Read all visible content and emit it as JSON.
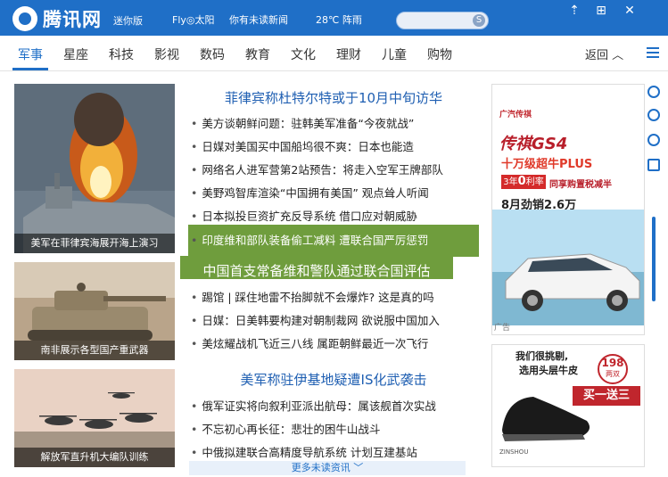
{
  "header": {
    "brand": "腾讯网",
    "mini_label": "迷你版",
    "weather_location": "Fly◎太阳",
    "news_notice": "你有未读新闻",
    "weather": "28℃ 阵雨"
  },
  "window": {
    "pin": "⇡",
    "restore": "⊞",
    "close": "✕"
  },
  "nav": {
    "items": [
      "军事",
      "星座",
      "科技",
      "影视",
      "数码",
      "教育",
      "文化",
      "理财",
      "儿童",
      "购物"
    ],
    "back_label": "返回 ︿"
  },
  "photos": [
    {
      "caption": "美军在菲律宾海展开海上演习"
    },
    {
      "caption": "南非展示各型国产重武器"
    },
    {
      "caption": "解放军直升机大编队训练"
    }
  ],
  "news": {
    "headline1": "菲律宾称杜特尔特或于10月中旬访华",
    "group1": [
      "美方谈朝鲜问题：驻韩美军准备“今夜就战”",
      "日媒对美国买中国船坞很不爽：日本也能造",
      "网络名人进军营第2站预告：将走入空军王牌部队",
      "美野鸡智库渲染“中国拥有美国” 观点耸人听闻",
      "日本拟投巨资扩充反导系统 借口应对朝威胁"
    ],
    "highlight_item": "印度维和部队装备偷工减料 遭联合国严厉惩罚",
    "headline2": "中国首支常备维和警队通过联合国评估",
    "group2": [
      "踢馆 | 踩住地雷不抬脚就不会爆炸? 这是真的吗",
      "日媒：日美韩要构建对朝制裁网 欲说服中国加入",
      "美炫耀战机飞近三八线 属距朝鲜最近一次飞行"
    ],
    "headline3": "美军称驻伊基地疑遭IS化武袭击",
    "group3": [
      "俄军证实将向叙利亚派出航母：属该舰首次实战",
      "不忘初心再长征：悲壮的困牛山战斗",
      "中俄拟建联合高精度导航系统 计划互建基站"
    ],
    "more": "更多未读资讯 ﹀"
  },
  "ads": {
    "ad1": {
      "brand": "广汽传祺",
      "model": "传祺GS4",
      "slogan": "十万级超牛PLUS",
      "rate_prefix": "3年",
      "rate_value": "0",
      "rate_suffix": "利率",
      "promo": "同享购置税减半",
      "sales": "8月劲销2.6万",
      "tag": "广告"
    },
    "ad2": {
      "line1": "我们很挑剔,",
      "line2": "选用头层牛皮",
      "price": "198",
      "price_unit": "两双",
      "offer": "买一送三",
      "shoe_brand": "ZINSHOU"
    }
  },
  "colors": {
    "header_blue": "#1f6fc7",
    "highlight_green": "#6f9d3d",
    "headline_blue": "#1f5fb2"
  }
}
